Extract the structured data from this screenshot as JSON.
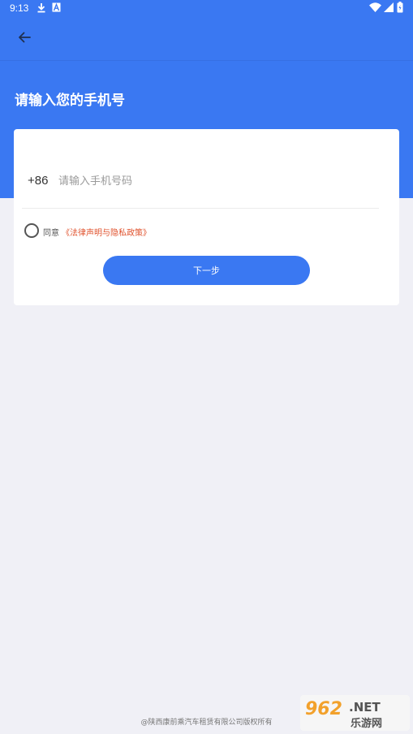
{
  "status_bar": {
    "time": "9:13",
    "icons": [
      "download-icon",
      "text-a-icon",
      "wifi-icon",
      "signal-icon",
      "battery-icon"
    ]
  },
  "toolbar": {
    "back_icon": "arrow-left-icon"
  },
  "page_title": "请输入您的手机号",
  "form": {
    "country_code": "+86",
    "phone_placeholder": "请输入手机号码",
    "phone_value": "",
    "agree_label": "同意",
    "policy_link": "《法律声明与隐私政策》",
    "agree_checked": false,
    "next_button": "下一步"
  },
  "footer": {
    "copyright": "@陕西康前乘汽车租赁有限公司版权所有"
  },
  "watermark": {
    "line1": "962.NET",
    "line2": "乐游网"
  },
  "colors": {
    "primary": "#3a78f2",
    "background": "#f0f0f6",
    "link": "#e0522d"
  }
}
